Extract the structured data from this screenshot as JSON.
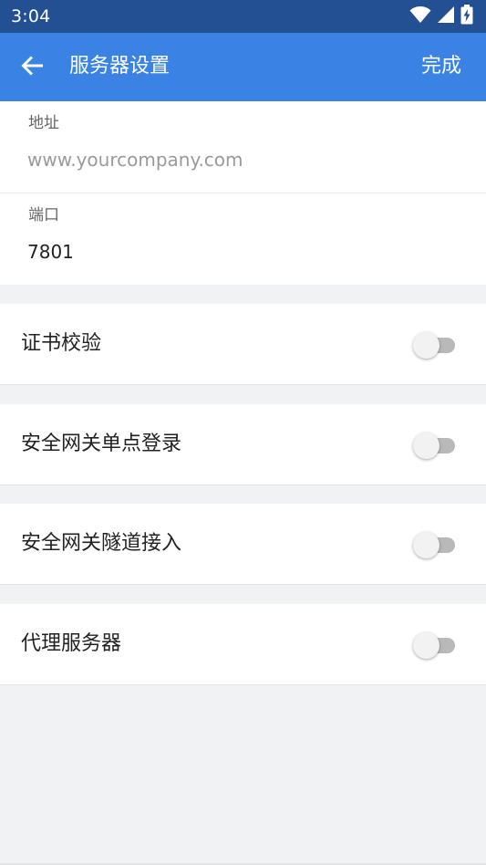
{
  "status_bar": {
    "time": "3:04",
    "icons": [
      "wifi-icon",
      "cell-signal-icon",
      "battery-charging-icon"
    ]
  },
  "app_bar": {
    "title": "服务器设置",
    "done_label": "完成",
    "back_icon": "arrow-left-icon"
  },
  "form": {
    "address": {
      "label": "地址",
      "value": "",
      "placeholder": "www.yourcompany.com"
    },
    "port": {
      "label": "端口",
      "value": "7801",
      "placeholder": ""
    }
  },
  "toggles": [
    {
      "label": "证书校验",
      "on": false
    },
    {
      "label": "安全网关单点登录",
      "on": false
    },
    {
      "label": "安全网关隧道接入",
      "on": false
    },
    {
      "label": "代理服务器",
      "on": false
    }
  ],
  "colors": {
    "status_bar": "#234f93",
    "app_bar": "#3a82e4",
    "background": "#f1f2f4",
    "switch_track_off": "#b9b9b9",
    "switch_thumb_off": "#f2f2f2"
  }
}
